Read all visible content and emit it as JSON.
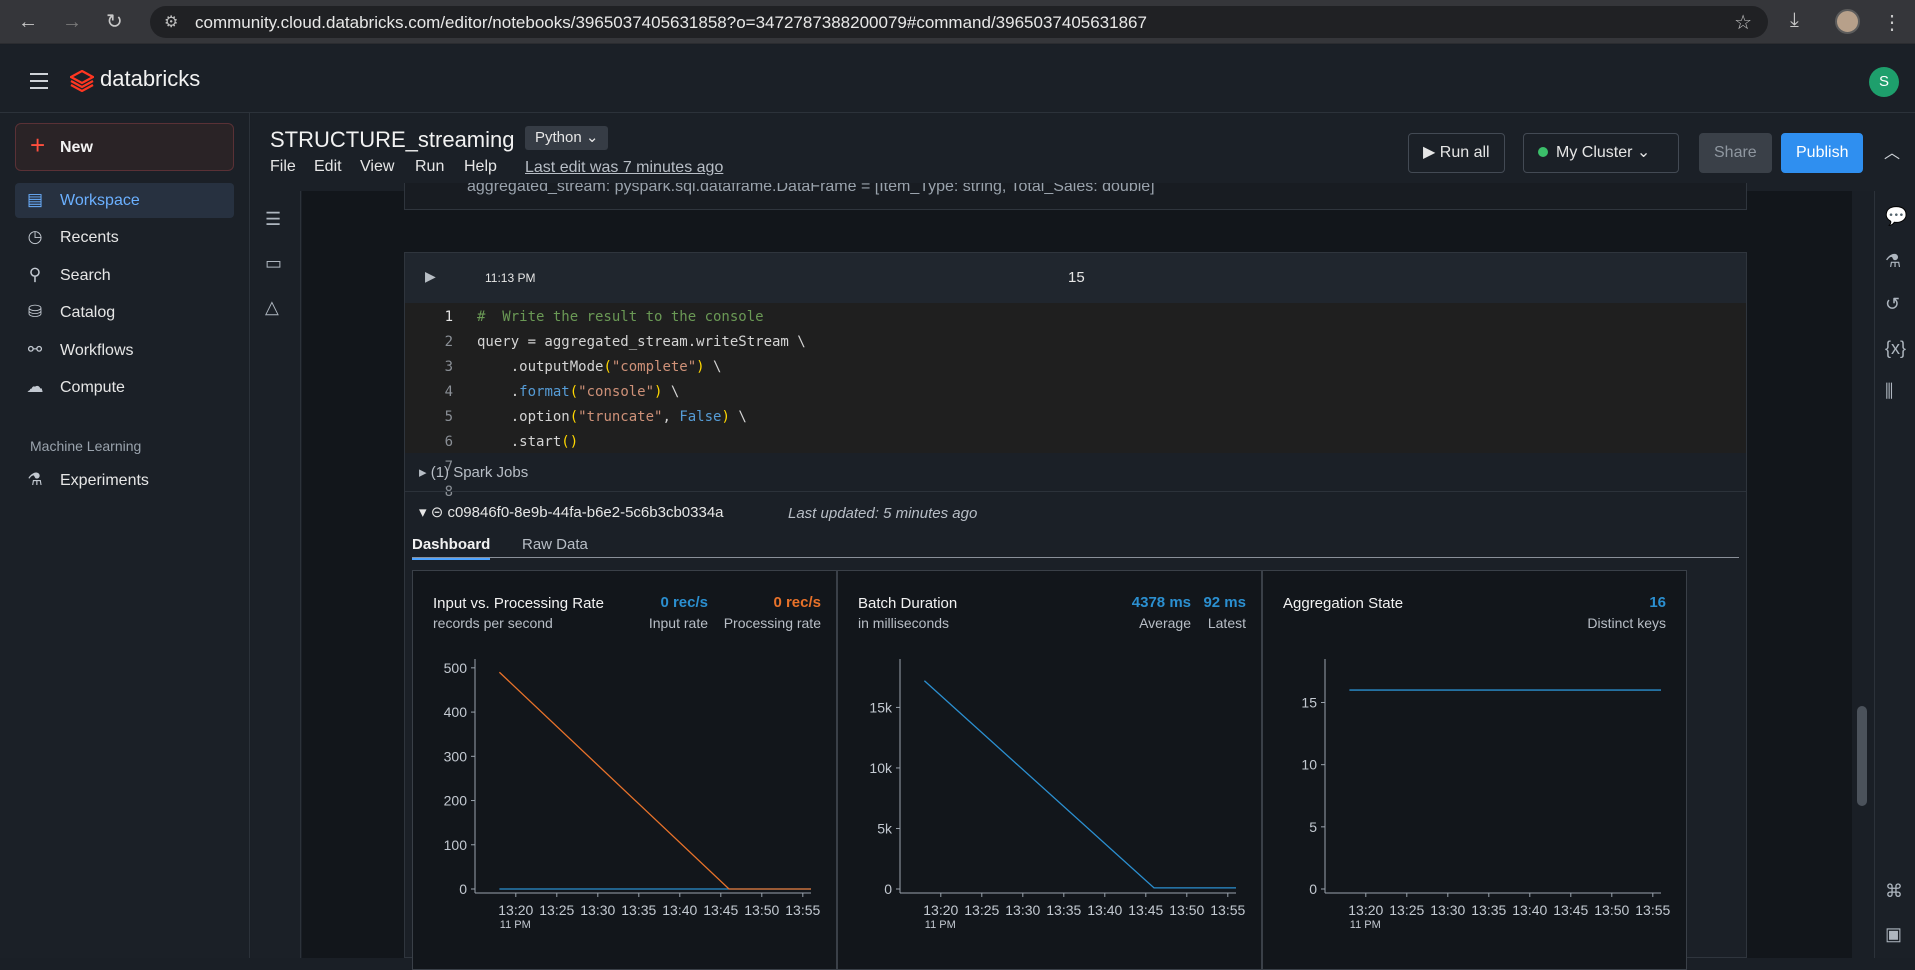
{
  "browser": {
    "url": "community.cloud.databricks.com/editor/notebooks/3965037405631858?o=3472787388200079#command/3965037405631867"
  },
  "app": {
    "brand": "databricks",
    "user_initial": "S"
  },
  "sidebar": {
    "new_label": "New",
    "items": [
      {
        "label": "Workspace",
        "icon": "workspace-icon"
      },
      {
        "label": "Recents",
        "icon": "clock-icon"
      },
      {
        "label": "Search",
        "icon": "search-icon"
      },
      {
        "label": "Catalog",
        "icon": "catalog-icon"
      },
      {
        "label": "Workflows",
        "icon": "workflows-icon"
      },
      {
        "label": "Compute",
        "icon": "cloud-icon"
      }
    ],
    "section_label": "Machine Learning",
    "ml_items": [
      {
        "label": "Experiments",
        "icon": "flask-icon"
      }
    ]
  },
  "notebook": {
    "title": "STRUCTURE_streaming",
    "language": "Python",
    "menu": [
      "File",
      "Edit",
      "View",
      "Run",
      "Help"
    ],
    "last_edit": "Last edit was 7 minutes ago",
    "run_all": "Run all",
    "cluster": "My Cluster",
    "share": "Share",
    "publish": "Publish"
  },
  "prev_cell_output": "aggregated_stream:  pyspark.sql.dataframe.DataFrame = [Item_Type: string, Total_Sales: double]",
  "cell": {
    "time": "11:13 PM",
    "number": "15",
    "line_numbers": [
      "1",
      "2",
      "3",
      "4",
      "5",
      "6",
      "7",
      "8"
    ],
    "spark_jobs": "(1) Spark Jobs",
    "query_id": "c09846f0-8e9b-44fa-b6e2-5c6b3cb0334a",
    "last_updated": "Last updated: 5 minutes ago",
    "tabs": [
      "Dashboard",
      "Raw Data"
    ]
  },
  "colors": {
    "input": "#2b8fd0",
    "processing": "#e8722a",
    "accent": "#2f8ff0"
  },
  "dashboard": {
    "time_axis_sublabel": "11 PM",
    "panels": [
      {
        "title": "Input vs. Processing Rate",
        "subtitle": "records per second",
        "metrics": [
          {
            "value": "0 rec/s",
            "label": "Input rate"
          },
          {
            "value": "0 rec/s",
            "label": "Processing rate"
          }
        ]
      },
      {
        "title": "Batch Duration",
        "subtitle": "in milliseconds",
        "metrics": [
          {
            "value": "4378 ms",
            "label": "Average"
          },
          {
            "value": "92 ms",
            "label": "Latest"
          }
        ]
      },
      {
        "title": "Aggregation State",
        "subtitle": "",
        "metrics": [
          {
            "value": "16",
            "label": "Distinct keys"
          }
        ]
      }
    ]
  },
  "chart_data": [
    {
      "type": "line",
      "title": "Input vs. Processing Rate",
      "x": [
        "13:18",
        "13:46",
        "13:56"
      ],
      "x_ticks": [
        "13:20",
        "13:25",
        "13:30",
        "13:35",
        "13:40",
        "13:45",
        "13:50",
        "13:55"
      ],
      "y_ticks": [
        "0",
        "100",
        "200",
        "300",
        "400",
        "500"
      ],
      "ylim": [
        0,
        520
      ],
      "series": [
        {
          "name": "Input rate",
          "values": [
            0,
            0,
            0
          ]
        },
        {
          "name": "Processing rate",
          "values": [
            490,
            0,
            0
          ]
        }
      ]
    },
    {
      "type": "line",
      "title": "Batch Duration",
      "x": [
        "13:18",
        "13:46",
        "13:56"
      ],
      "x_ticks": [
        "13:20",
        "13:25",
        "13:30",
        "13:35",
        "13:40",
        "13:45",
        "13:50",
        "13:55"
      ],
      "y_ticks": [
        "0",
        "5k",
        "10k",
        "15k"
      ],
      "ylim": [
        0,
        19000
      ],
      "series": [
        {
          "name": "Batch Duration",
          "values": [
            17200,
            92,
            92
          ]
        }
      ]
    },
    {
      "type": "line",
      "title": "Aggregation State",
      "x": [
        "13:18",
        "13:56"
      ],
      "x_ticks": [
        "13:20",
        "13:25",
        "13:30",
        "13:35",
        "13:40",
        "13:45",
        "13:50",
        "13:55"
      ],
      "y_ticks": [
        "0",
        "5",
        "10",
        "15"
      ],
      "ylim": [
        0,
        18.5
      ],
      "series": [
        {
          "name": "Distinct keys",
          "values": [
            16,
            16
          ]
        }
      ]
    }
  ]
}
